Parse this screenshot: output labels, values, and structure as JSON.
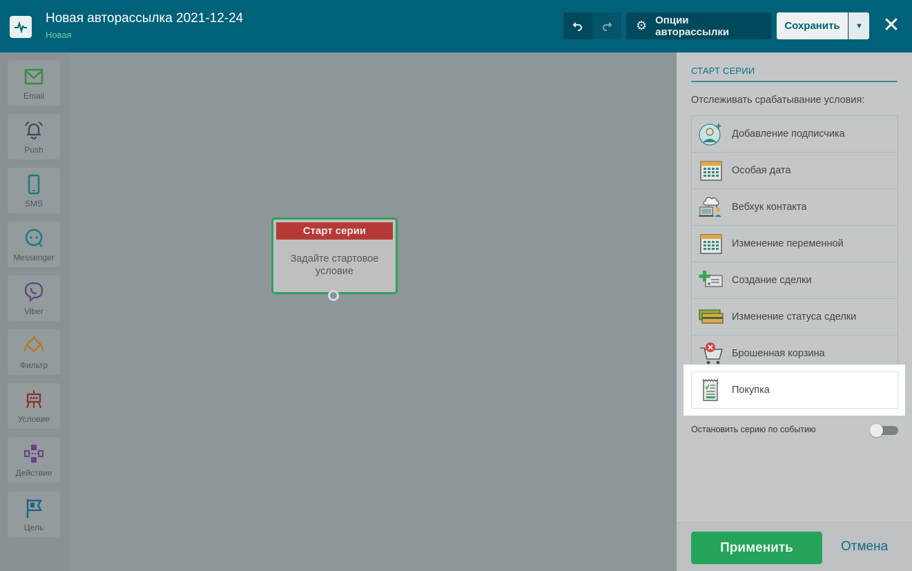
{
  "header": {
    "title": "Новая авторассылка 2021-12-24",
    "status": "Новая",
    "options_label": "Опции авторассылки",
    "save_label": "Сохранить"
  },
  "toolbox": {
    "items": [
      {
        "label": "Email",
        "icon": "email-icon",
        "color": "#3d8a45"
      },
      {
        "label": "Push",
        "icon": "bell-icon",
        "color": "#3a4d5a"
      },
      {
        "label": "SMS",
        "icon": "phone-icon",
        "color": "#1a7b7e"
      },
      {
        "label": "Messenger",
        "icon": "chat-icon",
        "color": "#1a7b8a"
      },
      {
        "label": "Viber",
        "icon": "viber-icon",
        "color": "#5c4a80"
      },
      {
        "label": "Фильтр",
        "icon": "filter-icon",
        "color": "#b07a1c"
      },
      {
        "label": "Условие",
        "icon": "condition-icon",
        "color": "#8a2f2f"
      },
      {
        "label": "Действие",
        "icon": "action-icon",
        "color": "#6b3f86"
      },
      {
        "label": "Цель",
        "icon": "flag-icon",
        "color": "#1e5f8a"
      }
    ]
  },
  "canvas": {
    "node_title": "Старт серии",
    "node_body": "Задайте стартовое условие"
  },
  "panel": {
    "title": "СТАРТ СЕРИИ",
    "subtitle": "Отслеживать срабатывание условия:",
    "conditions": [
      {
        "label": "Добавление подписчика",
        "icon": "subscriber-add-icon"
      },
      {
        "label": "Особая дата",
        "icon": "calendar-icon"
      },
      {
        "label": "Вебхук контакта",
        "icon": "webhook-icon"
      },
      {
        "label": "Изменение переменной",
        "icon": "calendar-icon"
      },
      {
        "label": "Создание сделки",
        "icon": "deal-create-icon"
      },
      {
        "label": "Изменение статуса сделки",
        "icon": "deal-status-icon"
      },
      {
        "label": "Брошенная корзина",
        "icon": "cart-icon"
      },
      {
        "label": "Покупка",
        "icon": "receipt-icon"
      }
    ],
    "stop_label": "Остановить серию по событию",
    "stop_enabled": false,
    "apply_label": "Применить",
    "cancel_label": "Отмена"
  },
  "colors": {
    "header_bg": "#00617a",
    "accent_green": "#25a35a",
    "node_red": "#b53a37"
  }
}
